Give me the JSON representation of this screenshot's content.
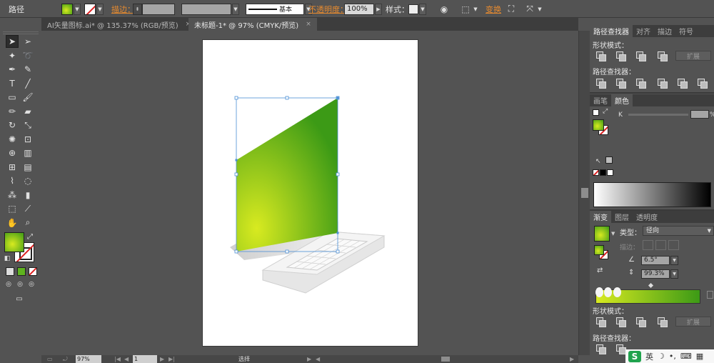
{
  "control_bar": {
    "title": "路径",
    "stroke_label": "描边：",
    "brush_label": "基本",
    "opacity_label": "不透明度：",
    "opacity_value": "100%",
    "style_label": "样式：",
    "transform_label": "变换",
    "fill_color": "#5fb31f"
  },
  "tabs": [
    {
      "label": "AI矢量图标.ai* @ 135.37% (RGB/预览)",
      "close": "×"
    },
    {
      "label": "未标题-1* @ 97% (CMYK/预览)",
      "close": "×"
    }
  ],
  "status": {
    "zoom": "97%",
    "page": "1",
    "tool": "选择"
  },
  "panels": {
    "pathfinder_tabs": [
      "路径查找器",
      "对齐",
      "描边",
      "符号"
    ],
    "shape_modes_label": "形状模式：",
    "pathfinders_label": "路径查找器：",
    "expand_label": "扩展",
    "color_tabs": [
      "画笔",
      "颜色"
    ],
    "k_label": "K",
    "k_unit": "%",
    "gradient_tabs": [
      "渐变",
      "图层",
      "透明度"
    ],
    "type_label": "类型：",
    "type_value": "径向",
    "stroke_label": "描边：",
    "angle_value": "6.5°",
    "aspect_value": "99.3%",
    "shape_modes_label_2": "形状模式：",
    "pathfinders_label_2": "路径查找器：",
    "expand_label_2": "扩展"
  },
  "gradient": {
    "start_color": "#d8ea20",
    "end_color": "#3c9a16"
  },
  "ime": {
    "logo": "S",
    "lang": "英"
  },
  "icons": [
    "selection-arrow",
    "direct-selection",
    "magic-wand",
    "lasso",
    "pen",
    "curvature",
    "type",
    "line",
    "rectangle",
    "paintbrush",
    "pencil",
    "eraser",
    "rotate",
    "scale",
    "warp",
    "free-transform",
    "shape-builder",
    "perspective",
    "mesh",
    "gradient",
    "eyedropper",
    "blend",
    "symbol-sprayer",
    "column-graph",
    "artboard",
    "slice",
    "hand",
    "zoom"
  ]
}
